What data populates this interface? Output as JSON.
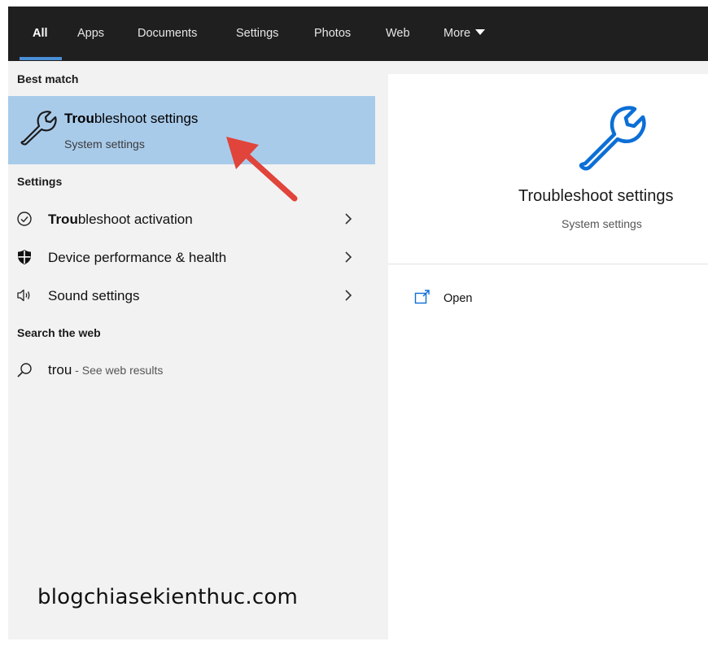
{
  "tabs": [
    {
      "label": "All",
      "active": true
    },
    {
      "label": "Apps"
    },
    {
      "label": "Documents"
    },
    {
      "label": "Settings"
    },
    {
      "label": "Photos"
    },
    {
      "label": "Web"
    },
    {
      "label": "More"
    }
  ],
  "best_match": {
    "header": "Best match",
    "title_bold": "Trou",
    "title_rest": "bleshoot settings",
    "subtitle": "System settings",
    "icon": "wrench-icon",
    "highlight_color": "#a9cbea"
  },
  "settings": {
    "header": "Settings",
    "items": [
      {
        "label_bold": "Trou",
        "label_rest": "bleshoot activation",
        "icon": "check-circle-icon"
      },
      {
        "label_bold": "",
        "label_rest": "Device performance & health",
        "icon": "shield-icon"
      },
      {
        "label_bold": "",
        "label_rest": "Sound settings",
        "icon": "speaker-icon"
      }
    ]
  },
  "web": {
    "header": "Search the web",
    "query": "trou",
    "suffix": " - See web results",
    "icon": "search-icon"
  },
  "preview": {
    "title": "Troubleshoot settings",
    "subtitle": "System settings",
    "open_label": "Open",
    "icon": "wrench-icon",
    "accent": "#0b6fd6"
  },
  "watermark": "blogchiasekienthuc.com"
}
